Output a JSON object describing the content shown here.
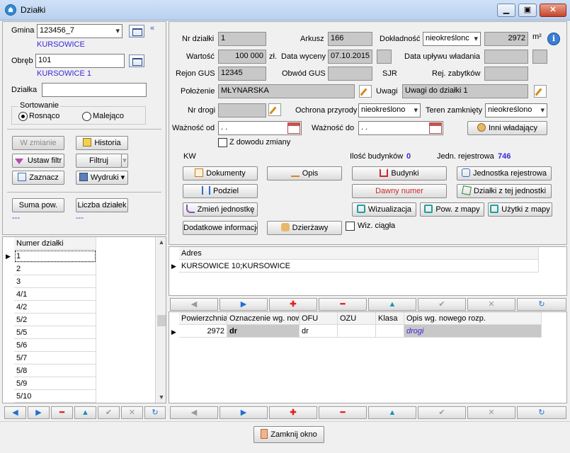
{
  "window": {
    "title": "Działki",
    "minimize": "▁",
    "restore": "▣",
    "close": "✕"
  },
  "left": {
    "gmina_label": "Gmina",
    "gmina_value": "123456_7",
    "gmina_name": "KURSOWICE",
    "obreb_label": "Obręb",
    "obreb_value": "101",
    "obreb_name": "KURSOWICE 1",
    "dzialka_label": "Działka",
    "dzialka_value": "",
    "sort_label": "Sortowanie",
    "sort_asc": "Rosnąco",
    "sort_desc": "Malejąco",
    "btn_w_zmianie": "W zmianie",
    "btn_historia": "Historia",
    "btn_ustaw_filtr": "Ustaw filtr",
    "btn_filtruj": "Filtruj",
    "btn_zaznacz": "Zaznacz",
    "btn_wydruki": "Wydruki",
    "btn_suma": "Suma pow.",
    "btn_liczba": "Liczba działek",
    "suma_value": "---",
    "liczba_value": "---",
    "list_header": "Numer działki",
    "list_items": [
      "1",
      "2",
      "3",
      "4/1",
      "4/2",
      "5/2",
      "5/5",
      "5/6",
      "5/7",
      "5/8",
      "5/9",
      "5/10"
    ]
  },
  "form": {
    "nr_dzialki_label": "Nr działki",
    "nr_dzialki": "1",
    "arkusz_label": "Arkusz",
    "arkusz": "166",
    "dokladnosc_label": "Dokładność",
    "dokladnosc": "nieokreślonc",
    "area": "2972",
    "area_unit": "m²",
    "wartosc_label": "Wartość",
    "wartosc": "100 000",
    "zl_label": "zł.",
    "data_wyceny_label": "Data wyceny",
    "data_wyceny": "07.10.2015",
    "data_uplywu_label": "Data upływu władania",
    "data_uplywu": "",
    "rejon_label": "Rejon GUS",
    "rejon": "12345",
    "obwod_label": "Obwód GUS",
    "obwod": "",
    "sjr_label": "SJR",
    "rej_zabytkow_label": "Rej. zabytków",
    "rej_zabytkow": "",
    "polozenie_label": "Położenie",
    "polozenie": "MŁYNARSKA",
    "uwagi_label": "Uwagi",
    "uwagi": "Uwagi do działki 1",
    "nr_drogi_label": "Nr drogi",
    "nr_drogi": "",
    "ochrona_label": "Ochrona przyrody",
    "ochrona": "nieokreślono",
    "teren_label": "Teren zamknięty",
    "teren": "nieokreślono",
    "waznosc_od_label": "Ważność od",
    "waznosc_od": ". .",
    "waznosc_do_label": "Ważność do",
    "waznosc_do": ". .",
    "inni_label": "Inni władający",
    "z_dowodu_label": "Z dowodu zmiany",
    "kw_label": "KW",
    "ilosc_bud_label": "Ilość budynków",
    "ilosc_bud": "0",
    "jedn_rej_label": "Jedn. rejestrowa",
    "jedn_rej": "746"
  },
  "actions": {
    "dokumenty": "Dokumenty",
    "opis": "Opis",
    "budynki": "Budynki",
    "jednostka": "Jednostka rejestrowa",
    "podziel": "Podziel",
    "dawny": "Dawny numer",
    "dzialki_z_jedn": "Działki z tej jednostki",
    "zmien": "Zmień jednostkę",
    "wizualizacja": "Wizualizacja",
    "pow_z_mapy": "Pow. z mapy",
    "uzytki_z_mapy": "Użytki z mapy",
    "dodatkowe": "Dodatkowe informacje",
    "dzierzawy": "Dzierżawy",
    "wiz_ciagla": "Wiz. ciągła"
  },
  "adres_grid": {
    "header": "Adres",
    "rows": [
      "KURSOWICE 10;KURSOWICE"
    ]
  },
  "uzytki_grid": {
    "headers": [
      "Powierzchnia",
      "Oznaczenie wg. now",
      "OFU",
      "OZU",
      "Klasa",
      "Opis wg. nowego rozp."
    ],
    "row": [
      "2972",
      "dr",
      "dr",
      "",
      "",
      "drogi"
    ]
  },
  "footer": {
    "close_label": "Zamknij okno"
  },
  "colors": {
    "accent_blue": "#3a28d9",
    "red": "#e02020",
    "nav_blue": "#1f6fd1"
  }
}
